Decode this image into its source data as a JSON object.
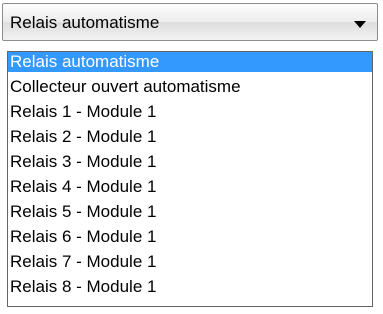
{
  "combo": {
    "value": "Relais automatisme",
    "arrow_icon": "chevron-down-icon"
  },
  "options": [
    {
      "label": "Relais automatisme",
      "selected": true
    },
    {
      "label": "Collecteur ouvert automatisme",
      "selected": false
    },
    {
      "label": "Relais 1 - Module 1",
      "selected": false
    },
    {
      "label": "Relais 2 - Module 1",
      "selected": false
    },
    {
      "label": "Relais 3 - Module 1",
      "selected": false
    },
    {
      "label": "Relais 4 - Module 1",
      "selected": false
    },
    {
      "label": "Relais 5 - Module 1",
      "selected": false
    },
    {
      "label": "Relais 6 - Module 1",
      "selected": false
    },
    {
      "label": "Relais 7 - Module 1",
      "selected": false
    },
    {
      "label": "Relais 8 - Module 1",
      "selected": false
    }
  ],
  "colors": {
    "selection_background": "#3399ff",
    "selection_text": "#ffffff",
    "dropdown_border": "#646464"
  }
}
